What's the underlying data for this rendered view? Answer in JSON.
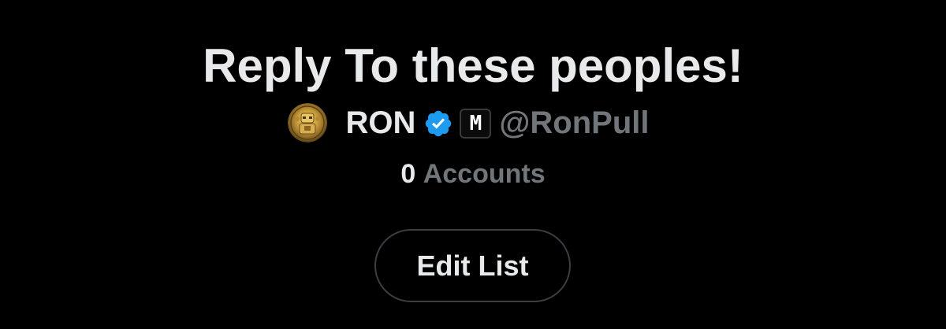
{
  "list": {
    "title": "Reply To these peoples!",
    "members_count": "0",
    "members_label": "Accounts"
  },
  "owner": {
    "name": "RON",
    "verified_icon": "verified-badge-icon",
    "affiliate_badge": "M",
    "handle": "@RonPull"
  },
  "actions": {
    "edit_label": "Edit List"
  },
  "colors": {
    "background": "#000000",
    "primary_text": "#e7e9ea",
    "secondary_text": "#71767b",
    "verified_blue": "#1d9bf0",
    "button_border": "#3b3e42"
  }
}
